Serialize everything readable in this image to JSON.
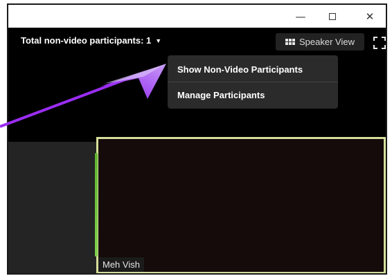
{
  "titlebar": {
    "minimize_symbol": "—",
    "close_symbol": "✕"
  },
  "toolbar": {
    "participants_label": "Total non-video participants: 1",
    "dropdown_caret": "▼",
    "speaker_view_label": "Speaker View",
    "speaker_view_icon": "grid-icon",
    "fullscreen_icon": "fullscreen-icon"
  },
  "menu": {
    "items": [
      {
        "label": "Show Non-Video Participants"
      },
      {
        "label": "Manage Participants"
      }
    ]
  },
  "video_tile": {
    "name": "Meh Vish"
  },
  "colors": {
    "arrow": "#9b2df2",
    "tile_border": "#d6de9a",
    "menu_bg": "#2b2b2b"
  }
}
